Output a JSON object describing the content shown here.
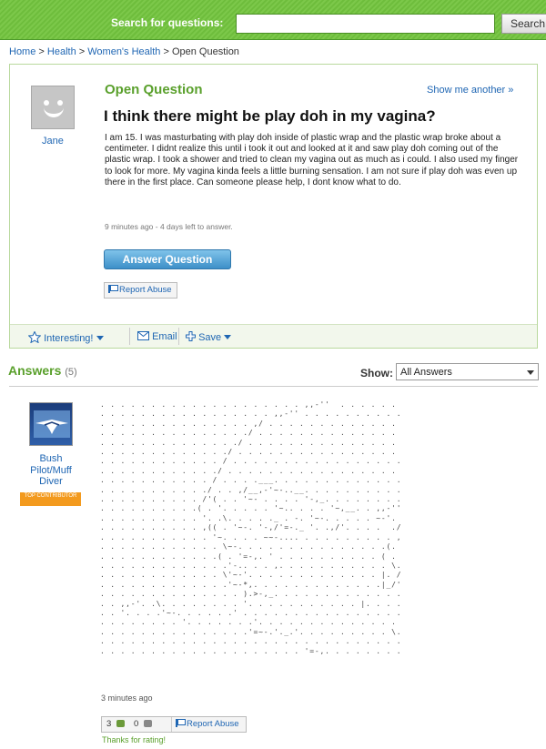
{
  "search": {
    "label": "Search for questions:",
    "placeholder": "",
    "button": "Search"
  },
  "breadcrumb": {
    "items": [
      "Home",
      "Health",
      "Women's Health"
    ],
    "current": "Open Question",
    "separator": " > "
  },
  "question": {
    "status": "Open Question",
    "show_another": "Show me another »",
    "asker": "Jane",
    "title": "I think there might be play doh in my vagina?",
    "body": "I am 15. I was masturbating with play doh inside of plastic wrap and the plastic wrap broke about a centimeter. I didnt realize this until i took it out and looked at it and saw play doh coming out of the plastic wrap. I took a shower and tried to clean my vagina out as much as i could. I also used my finger to look for more. My vagina kinda feels a little burning sensation. I am not sure if play doh was even up there in the first place. Can someone please help, I dont know what to do.",
    "meta": "9 minutes ago - 4 days left to answer.",
    "answer_button": "Answer Question",
    "report_abuse": "Report Abuse",
    "actions": {
      "interesting": "Interesting!",
      "email": "Email",
      "save": "Save"
    }
  },
  "answers": {
    "heading": "Answers",
    "count": "(5)",
    "show_label": "Show:",
    "show_selected": "All Answers",
    "first": {
      "name": "Bush Pilot/Muff Diver",
      "badge": "TOP CONTRIBUTOR",
      "time": "3 minutes ago",
      "thumbs_up": "3",
      "thumbs_down": "0",
      "report_abuse": "Report Abuse",
      "thanks": "Thanks for rating!"
    }
  },
  "colors": {
    "brand_green": "#7cc84a",
    "title_green": "#5aa02c",
    "link_blue": "#1f66b3",
    "badge_orange": "#f39a1e"
  },
  "icons": [
    "star-icon",
    "envelope-icon",
    "plus-icon",
    "flag-icon",
    "thumbs-up-icon",
    "thumbs-down-icon",
    "chevron-down-icon"
  ]
}
